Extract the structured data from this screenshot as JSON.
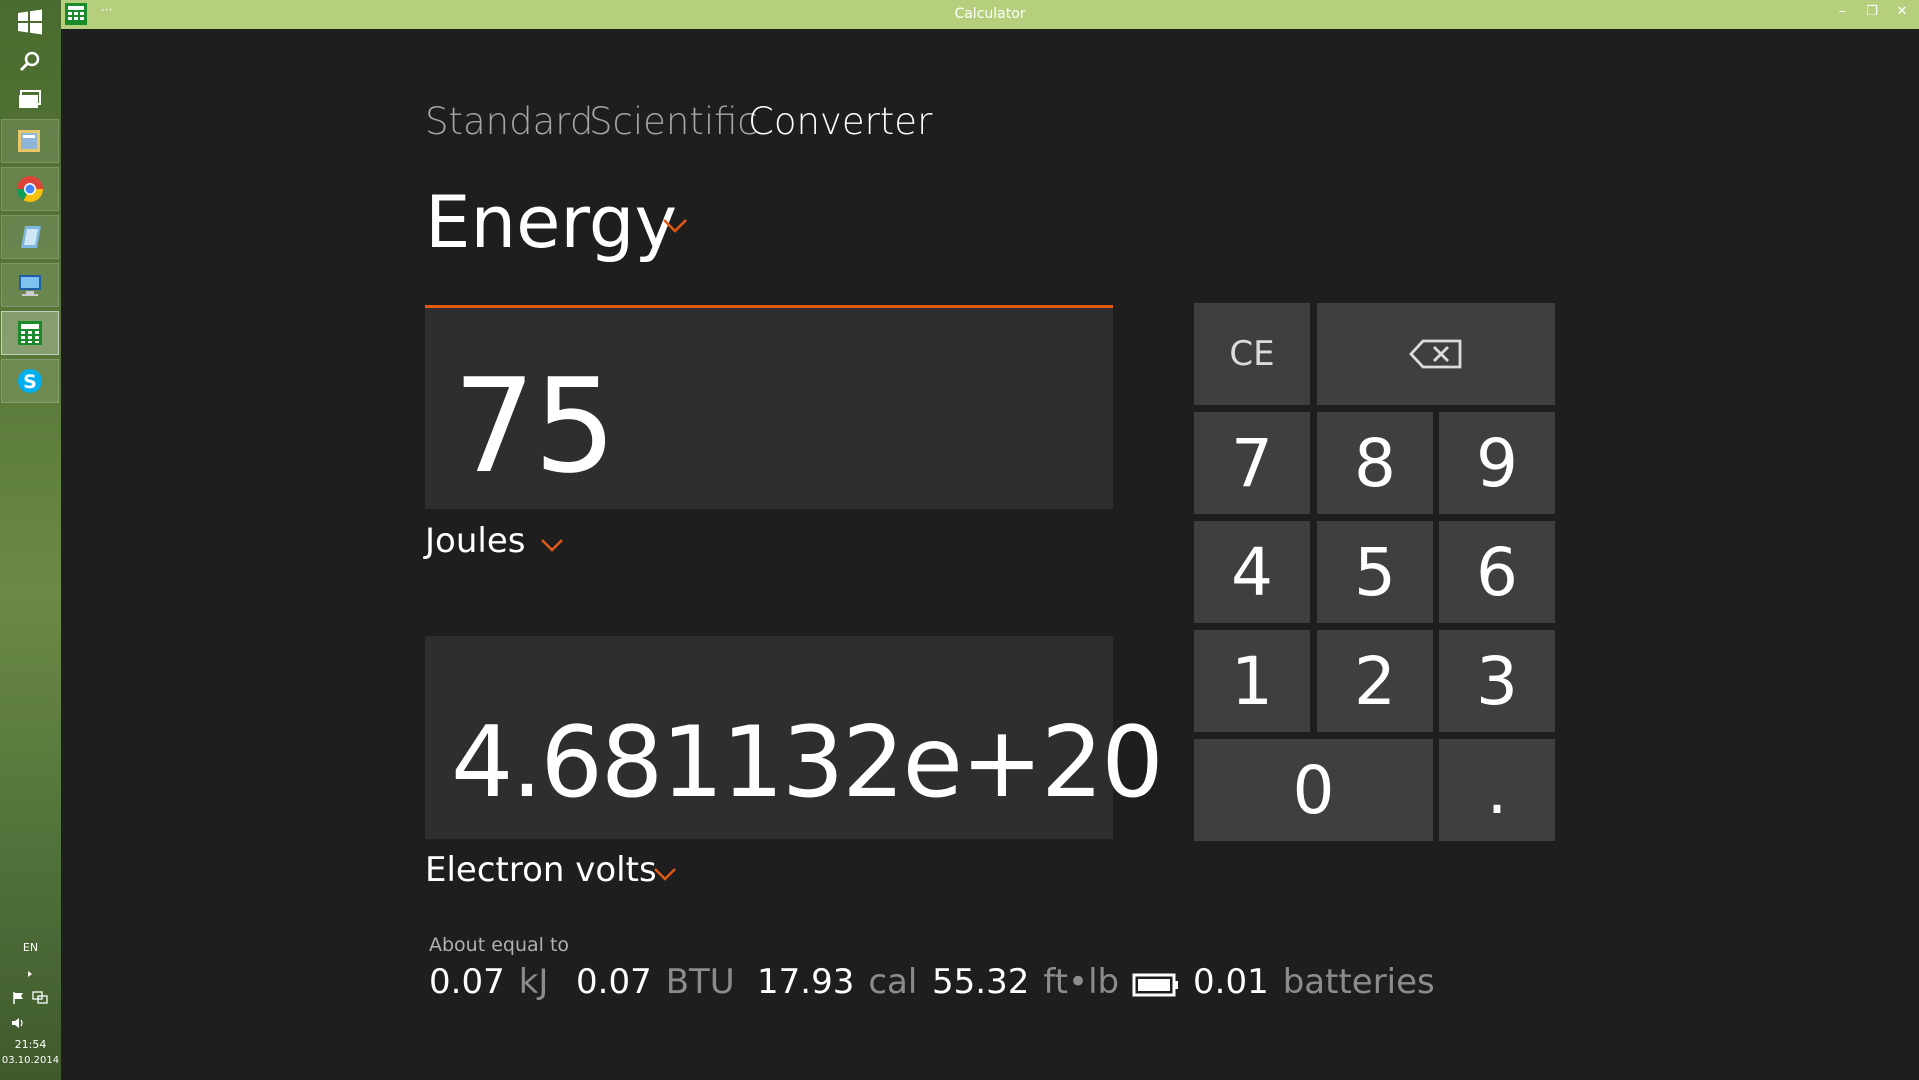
{
  "window": {
    "title": "Calculator",
    "menu_dots": "···",
    "minimize": "–",
    "restore": "❐",
    "close": "✕"
  },
  "taskbar": {
    "language": "EN",
    "time": "21:54",
    "date": "03.10.2014",
    "apps": [
      "start-icon",
      "search-icon",
      "task-view-icon",
      "file-explorer-icon",
      "chrome-icon",
      "notepad-icon",
      "remote-desktop-icon",
      "calculator-icon",
      "skype-icon"
    ]
  },
  "modes": {
    "standard": "Standard",
    "scientific": "Scientific",
    "converter": "Converter"
  },
  "converter": {
    "category": "Energy",
    "from_value": "75",
    "from_unit": "Joules",
    "to_value": "4.681132e+20",
    "to_unit": "Electron volts"
  },
  "keypad": {
    "ce": "CE",
    "backspace_icon": "backspace-icon",
    "k7": "7",
    "k8": "8",
    "k9": "9",
    "k4": "4",
    "k5": "5",
    "k6": "6",
    "k1": "1",
    "k2": "2",
    "k3": "3",
    "k0": "0",
    "dot": "."
  },
  "about": {
    "label": "About equal to",
    "items": [
      {
        "value": "0.07",
        "unit": "kJ"
      },
      {
        "value": "0.07",
        "unit": "BTU"
      },
      {
        "value": "17.93",
        "unit": "cal"
      },
      {
        "value": "55.32",
        "unit": "ft•lb"
      },
      {
        "value": "0.01",
        "unit": "batteries"
      }
    ]
  },
  "colors": {
    "accent": "#e05a12",
    "background": "#1e1e1e",
    "panel": "#2e2e2e",
    "key": "#3f3f3f",
    "titlebar": "#b5cf7d"
  }
}
